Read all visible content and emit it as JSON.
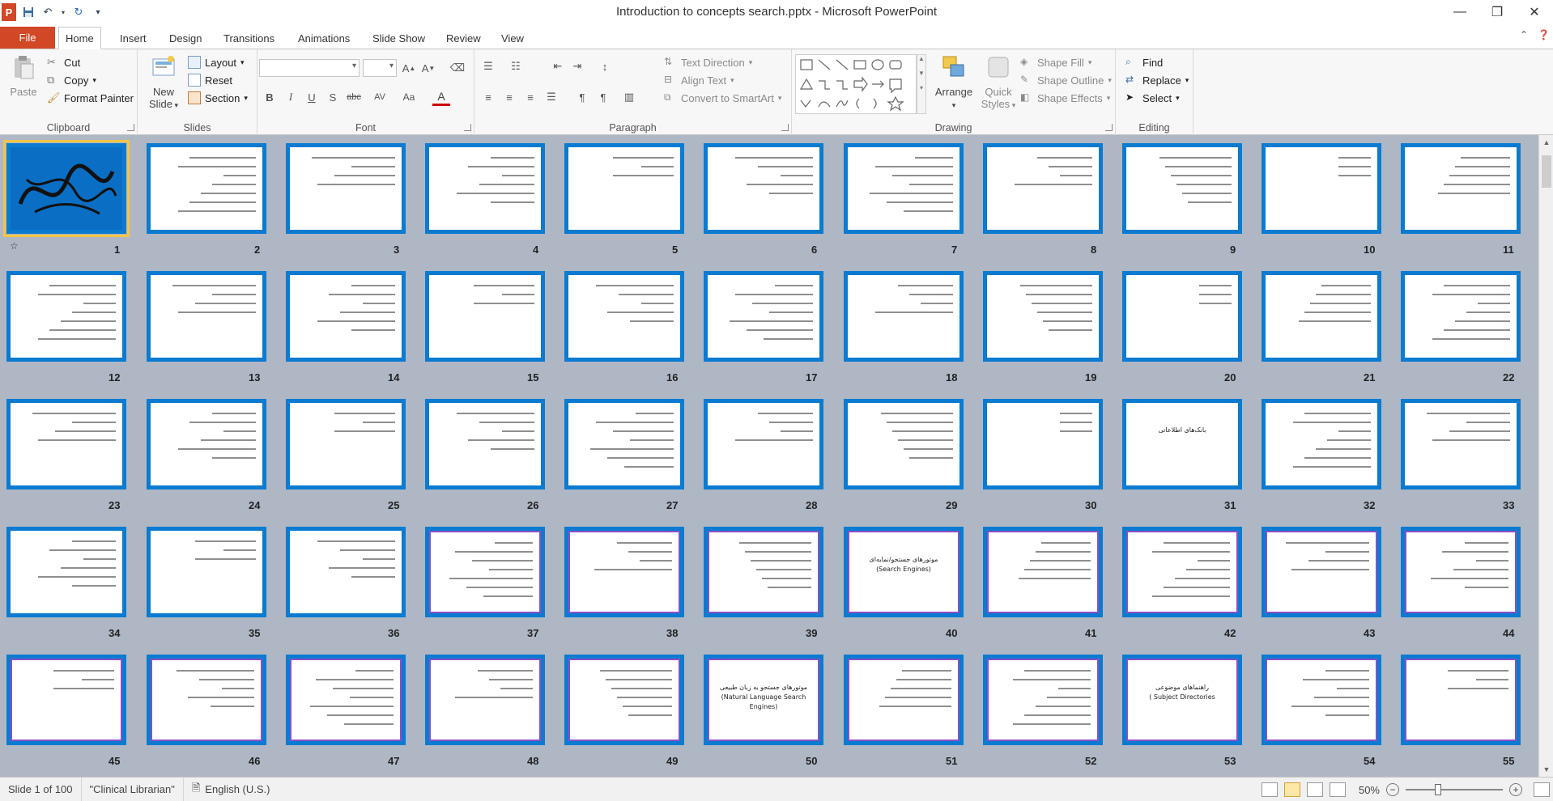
{
  "window": {
    "title": "Introduction to concepts search.pptx  -  Microsoft PowerPoint",
    "app_letter": "P"
  },
  "tabs": {
    "file": "File",
    "items": [
      "Home",
      "Insert",
      "Design",
      "Transitions",
      "Animations",
      "Slide Show",
      "Review",
      "View"
    ],
    "active": "Home"
  },
  "ribbon": {
    "clipboard": {
      "label": "Clipboard",
      "paste": "Paste",
      "cut": "Cut",
      "copy": "Copy",
      "format_painter": "Format Painter"
    },
    "slides": {
      "label": "Slides",
      "new_slide_line1": "New",
      "new_slide_line2": "Slide",
      "layout": "Layout",
      "reset": "Reset",
      "section": "Section"
    },
    "font": {
      "label": "Font",
      "buttons": [
        "B",
        "I",
        "U",
        "S",
        "abc",
        "AV",
        "Aa",
        "A"
      ]
    },
    "paragraph": {
      "label": "Paragraph",
      "text_direction": "Text Direction",
      "align_text": "Align Text",
      "convert_smartart": "Convert to SmartArt"
    },
    "drawing": {
      "label": "Drawing",
      "arrange": "Arrange",
      "quick_styles_line1": "Quick",
      "quick_styles_line2": "Styles",
      "shape_fill": "Shape Fill",
      "shape_outline": "Shape Outline",
      "shape_effects": "Shape Effects"
    },
    "editing": {
      "label": "Editing",
      "find": "Find",
      "replace": "Replace",
      "select": "Select"
    }
  },
  "slide_labels": [
    "1",
    "2",
    "3",
    "4",
    "5",
    "6",
    "7",
    "8",
    "9",
    "10",
    "11",
    "12",
    "13",
    "14",
    "15",
    "16",
    "17",
    "18",
    "19",
    "20",
    "21",
    "22",
    "23",
    "24",
    "25",
    "26",
    "27",
    "28",
    "29",
    "30",
    "31",
    "32",
    "33",
    "34",
    "35",
    "36",
    "37",
    "38",
    "39",
    "40",
    "41",
    "42",
    "43",
    "44",
    "45",
    "46",
    "47",
    "48",
    "49",
    "50",
    "51",
    "52",
    "53",
    "54",
    "55"
  ],
  "slide_texts": {
    "s31": "بانک‌های اطلاعاتی",
    "s40_line1": "موتورهای جستجو/نمایه‌ای",
    "s40_line2": "(Search Engines)",
    "s50_line1": "موتورهای جستجو به زبان طبیعی",
    "s50_line2": "(Natural Language Search Engines)",
    "s53_line1": "راهنماهای موضوعی",
    "s53_line2": "( Subject Directories"
  },
  "selected_slide": "1",
  "status": {
    "slide_of": "Slide 1 of 100",
    "theme": "\"Clinical Librarian\"",
    "language": "English (U.S.)",
    "zoom": "50%"
  },
  "colors": {
    "accent_file": "#d24726",
    "slide_frame": "#0a7bd1",
    "sorter_bg": "#afb7c4",
    "selection": "#f3c445"
  }
}
